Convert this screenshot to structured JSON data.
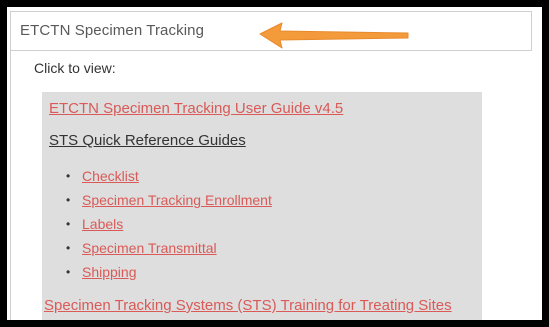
{
  "header": {
    "title": "ETCTN Specimen Tracking"
  },
  "content": {
    "click_label": "Click to view:",
    "user_guide_link": "ETCTN Specimen Tracking User Guide v4.5",
    "quick_ref_heading": "STS Quick Reference Guides",
    "quick_ref_items": [
      "Checklist",
      "Specimen Tracking Enrollment",
      "Labels",
      "Specimen Transmittal",
      "Shipping"
    ],
    "training_link": "Specimen Tracking Systems (STS) Training for Treating Sites"
  },
  "colors": {
    "link": "#d95a57",
    "panel": "#dedede",
    "arrow": "#f39a3b"
  },
  "annotation": {
    "icon": "arrow-left-icon"
  }
}
